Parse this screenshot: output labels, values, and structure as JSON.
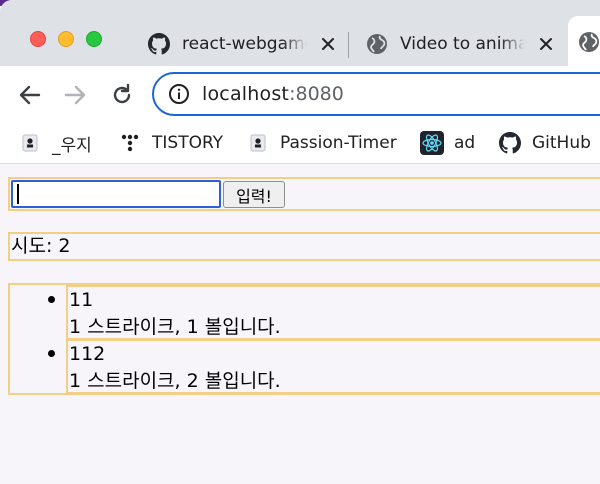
{
  "browser": {
    "tabs": [
      {
        "title": "react-webgame",
        "icon": "github-icon"
      },
      {
        "title": "Video to animat",
        "icon": "globe-icon"
      },
      {
        "title": "",
        "icon": "globe-icon",
        "active": true
      }
    ],
    "address": {
      "host": "localhost",
      "port": ":8080"
    },
    "bookmarks": [
      {
        "label": "_우지",
        "icon": "page-icon"
      },
      {
        "label": "TISTORY",
        "icon": "tistory-icon"
      },
      {
        "label": "Passion-Timer",
        "icon": "page-icon"
      },
      {
        "label": "ad",
        "icon": "react-icon"
      },
      {
        "label": "GitHub",
        "icon": "github-icon"
      }
    ]
  },
  "game": {
    "input_value": "",
    "submit_label": "입력!",
    "tries_text": "시도: 2",
    "history": [
      {
        "guess": "11",
        "result": "1 스트라이크, 1 볼입니다."
      },
      {
        "guess": "112",
        "result": "1 스트라이크, 2 볼입니다."
      }
    ]
  },
  "colors": {
    "outline": "#f2cf86",
    "focus": "#2f5fd6",
    "omnibox_border": "#1a66d6"
  }
}
